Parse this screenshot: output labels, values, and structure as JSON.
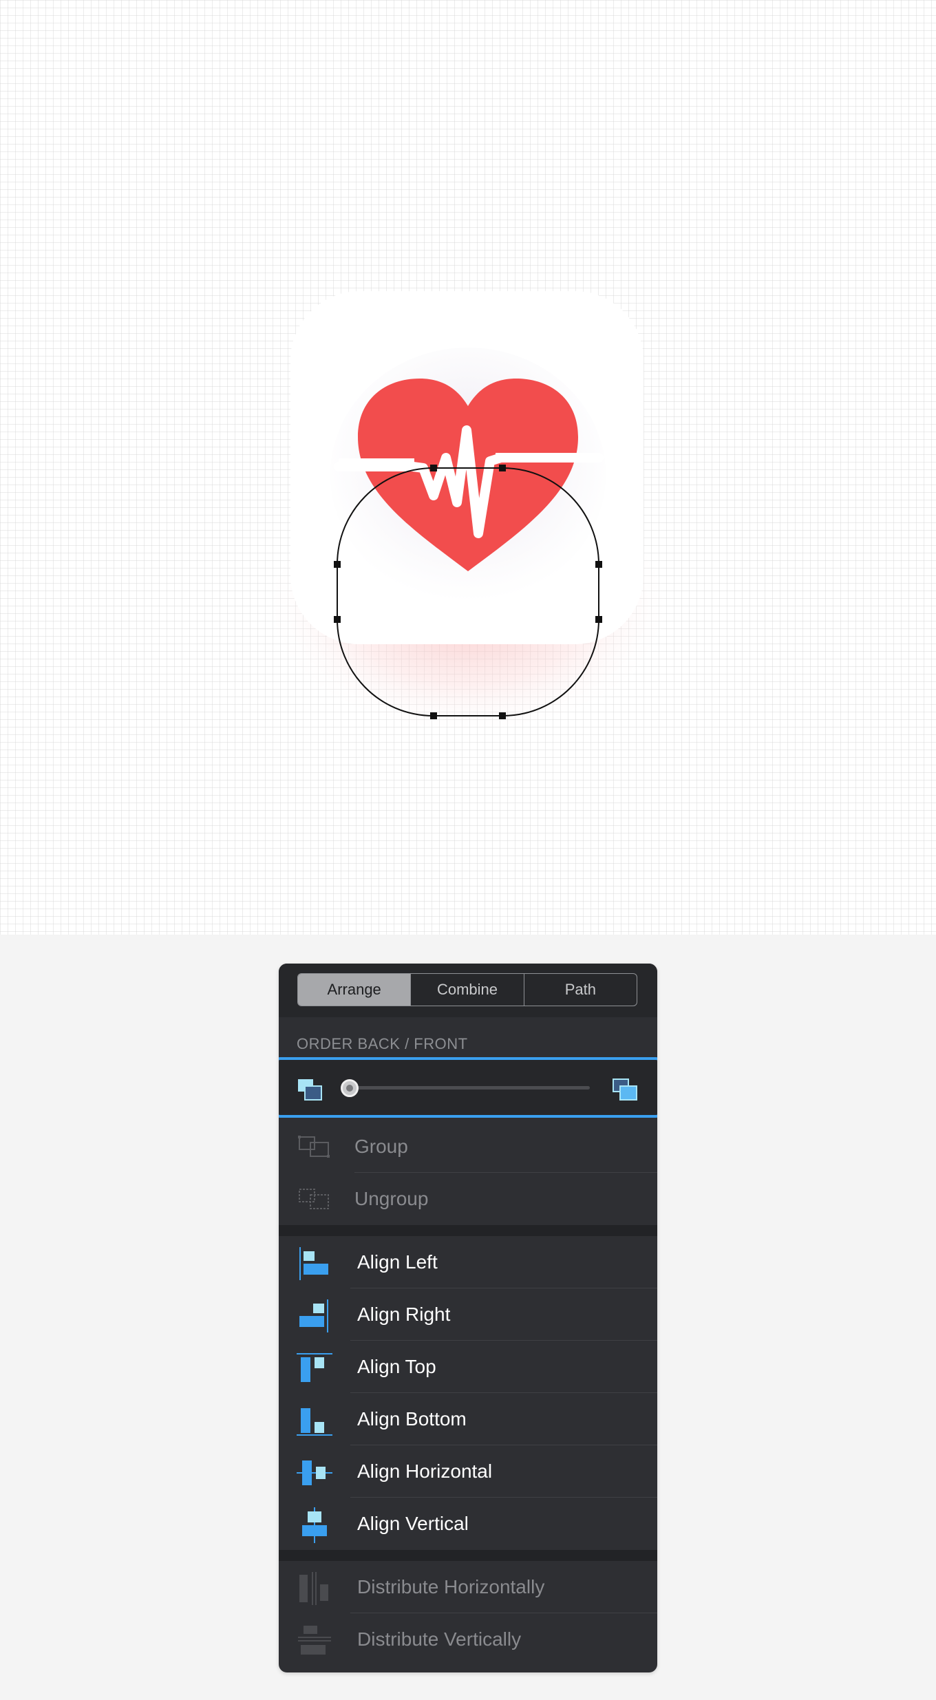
{
  "tabs": [
    {
      "label": "Arrange",
      "active": true
    },
    {
      "label": "Combine",
      "active": false
    },
    {
      "label": "Path",
      "active": false
    }
  ],
  "order": {
    "title": "ORDER BACK / FRONT",
    "slider_value": 0
  },
  "group_items": [
    {
      "label": "Group",
      "enabled": false,
      "icon": "group-icon"
    },
    {
      "label": "Ungroup",
      "enabled": false,
      "icon": "ungroup-icon"
    }
  ],
  "align_items": [
    {
      "label": "Align Left",
      "icon": "align-left-icon"
    },
    {
      "label": "Align Right",
      "icon": "align-right-icon"
    },
    {
      "label": "Align Top",
      "icon": "align-top-icon"
    },
    {
      "label": "Align Bottom",
      "icon": "align-bottom-icon"
    },
    {
      "label": "Align Horizontal",
      "icon": "align-horizontal-icon"
    },
    {
      "label": "Align Vertical",
      "icon": "align-vertical-icon"
    }
  ],
  "distribute_items": [
    {
      "label": "Distribute Horizontally",
      "enabled": false,
      "icon": "distribute-horizontally-icon"
    },
    {
      "label": "Distribute Vertically",
      "enabled": false,
      "icon": "distribute-vertically-icon"
    }
  ],
  "colors": {
    "accent_blue": "#3a9fef",
    "light_blue": "#a8e4f5",
    "heart_red": "#f24d4d",
    "panel_bg": "#2e2f33"
  }
}
